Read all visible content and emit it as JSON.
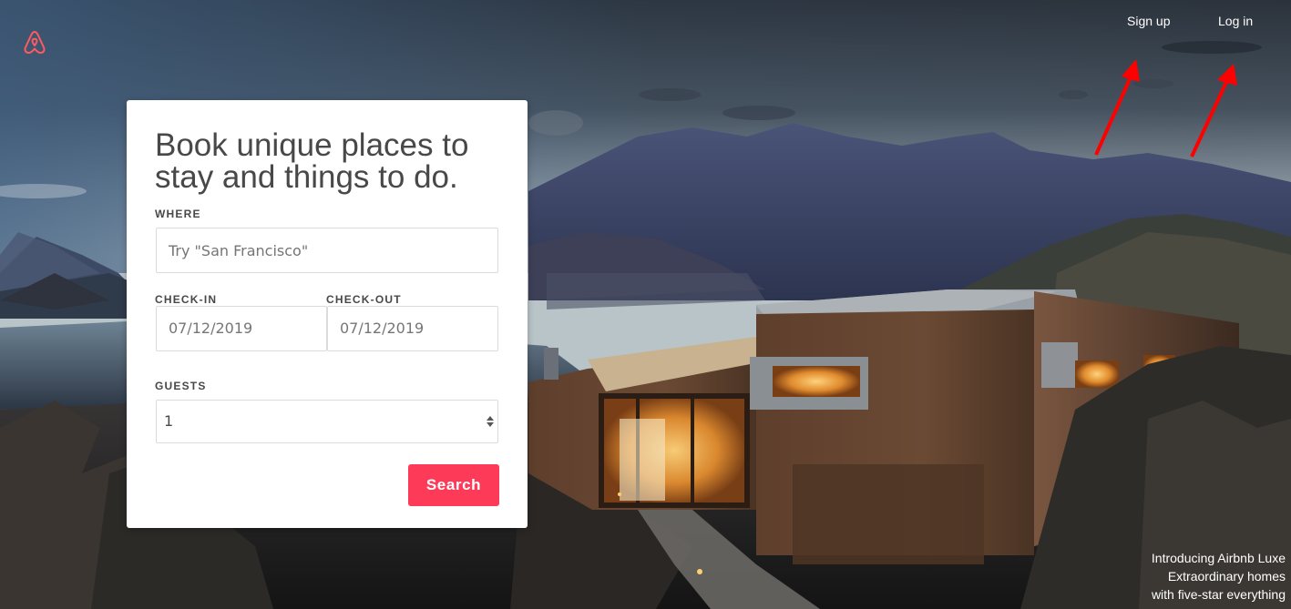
{
  "nav": {
    "signup_label": "Sign up",
    "login_label": "Log in"
  },
  "card": {
    "title": "Book unique places to stay and things to do.",
    "where": {
      "label": "WHERE",
      "placeholder": "Try \"San Francisco\""
    },
    "checkin": {
      "label": "CHECK-IN",
      "value": "07/12/2019"
    },
    "checkout": {
      "label": "CHECK-OUT",
      "value": "07/12/2019"
    },
    "guests": {
      "label": "GUESTS",
      "value": "1"
    },
    "search_label": "Search"
  },
  "promo": {
    "line1": "Introducing Airbnb Luxe",
    "line2": "Extraordinary homes",
    "line3": "with five-star everything"
  },
  "colors": {
    "brand": "#ff5a5f",
    "search_button": "#fd3b58",
    "annotation_arrow": "#ff0000"
  },
  "icons": {
    "logo": "airbnb-logo-icon",
    "select_arrows": "updown-chevron-icon"
  }
}
